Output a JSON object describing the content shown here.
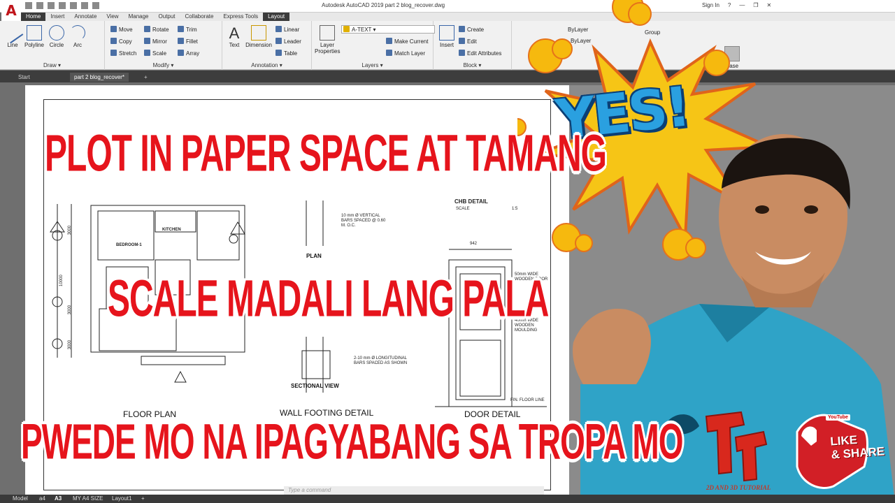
{
  "app": {
    "logo": "A",
    "title": "Autodesk AutoCAD 2019    part 2 blog_recover.dwg",
    "sign_in": "Sign In",
    "help": "?"
  },
  "ribbon_tabs": [
    "Home",
    "Insert",
    "Annotate",
    "View",
    "Manage",
    "Output",
    "Collaborate",
    "Express Tools",
    "Layout"
  ],
  "active_tab": "Home",
  "ribbon": {
    "draw": {
      "title": "Draw ▾",
      "tools": [
        "Line",
        "Polyline",
        "Circle",
        "Arc"
      ]
    },
    "modify": {
      "title": "Modify ▾",
      "tools": [
        "Move",
        "Rotate",
        "Trim",
        "Copy",
        "Mirror",
        "Fillet",
        "Stretch",
        "Scale",
        "Array"
      ]
    },
    "annotation": {
      "title": "Annotation ▾",
      "tools": [
        "Text",
        "Dimension",
        "Linear",
        "Leader",
        "Table"
      ]
    },
    "layers": {
      "title": "Layers ▾",
      "layer_properties": "Layer Properties",
      "current_layer": "A-TEXT",
      "tools": [
        "Make Current",
        "Match Layer"
      ]
    },
    "block": {
      "title": "Block ▾",
      "insert": "Insert",
      "tools": [
        "Create",
        "Edit",
        "Edit Attributes"
      ]
    },
    "properties": {
      "bylayer1": "ByLayer",
      "bylayer2": "ByLayer"
    },
    "groups": {
      "label": "Group"
    },
    "view": {
      "base": "Base"
    }
  },
  "doc_tabs": [
    "Start",
    "part 2 blog_recover*",
    "+"
  ],
  "drawing": {
    "floor_plan": "FLOOR PLAN",
    "wall_footing": "WALL FOOTING DETAIL",
    "door_detail": "DOOR DETAIL",
    "plan": "PLAN",
    "sectional_view": "SECTIONAL VIEW",
    "kitchen": "KITCHEN",
    "bedroom": "BEDROOM-1",
    "notes": [
      "10 mm Ø VERTICAL BARS SPACED @ 0.60 M. O.C.",
      "2-10 mm Ø LONGITUDINAL BARS SPACED AS SHOWN",
      "50mm WIDE WOODEN DOOR",
      "40mm WIDE WOODEN MOULDING",
      "FIN. FLOOR LINE"
    ],
    "chb_detail": "CHB DETAIL",
    "scale_label": "SCALE",
    "scale_value": "1:5",
    "dim_942": "942",
    "dims": [
      "3000",
      "3000",
      "10000",
      "3000"
    ]
  },
  "overlay": {
    "line1": "PLOT IN PAPER SPACE AT TAMANG",
    "line2": "SCALE MADALI LANG PALA",
    "line3": "PWEDE MO NA IPAGYABANG SA TROPA MO",
    "yes": "YES!"
  },
  "command_placeholder": "Type a command",
  "layout_tabs": [
    "Model",
    "a4",
    "A3",
    "MY A4 SIZE",
    "Layout1",
    "+"
  ],
  "active_layout": "A3",
  "branding": {
    "youtube": "YouTube",
    "like": "LIKE",
    "share": "& SHARE",
    "channel": "2D AND 3D TUTORIAL"
  }
}
